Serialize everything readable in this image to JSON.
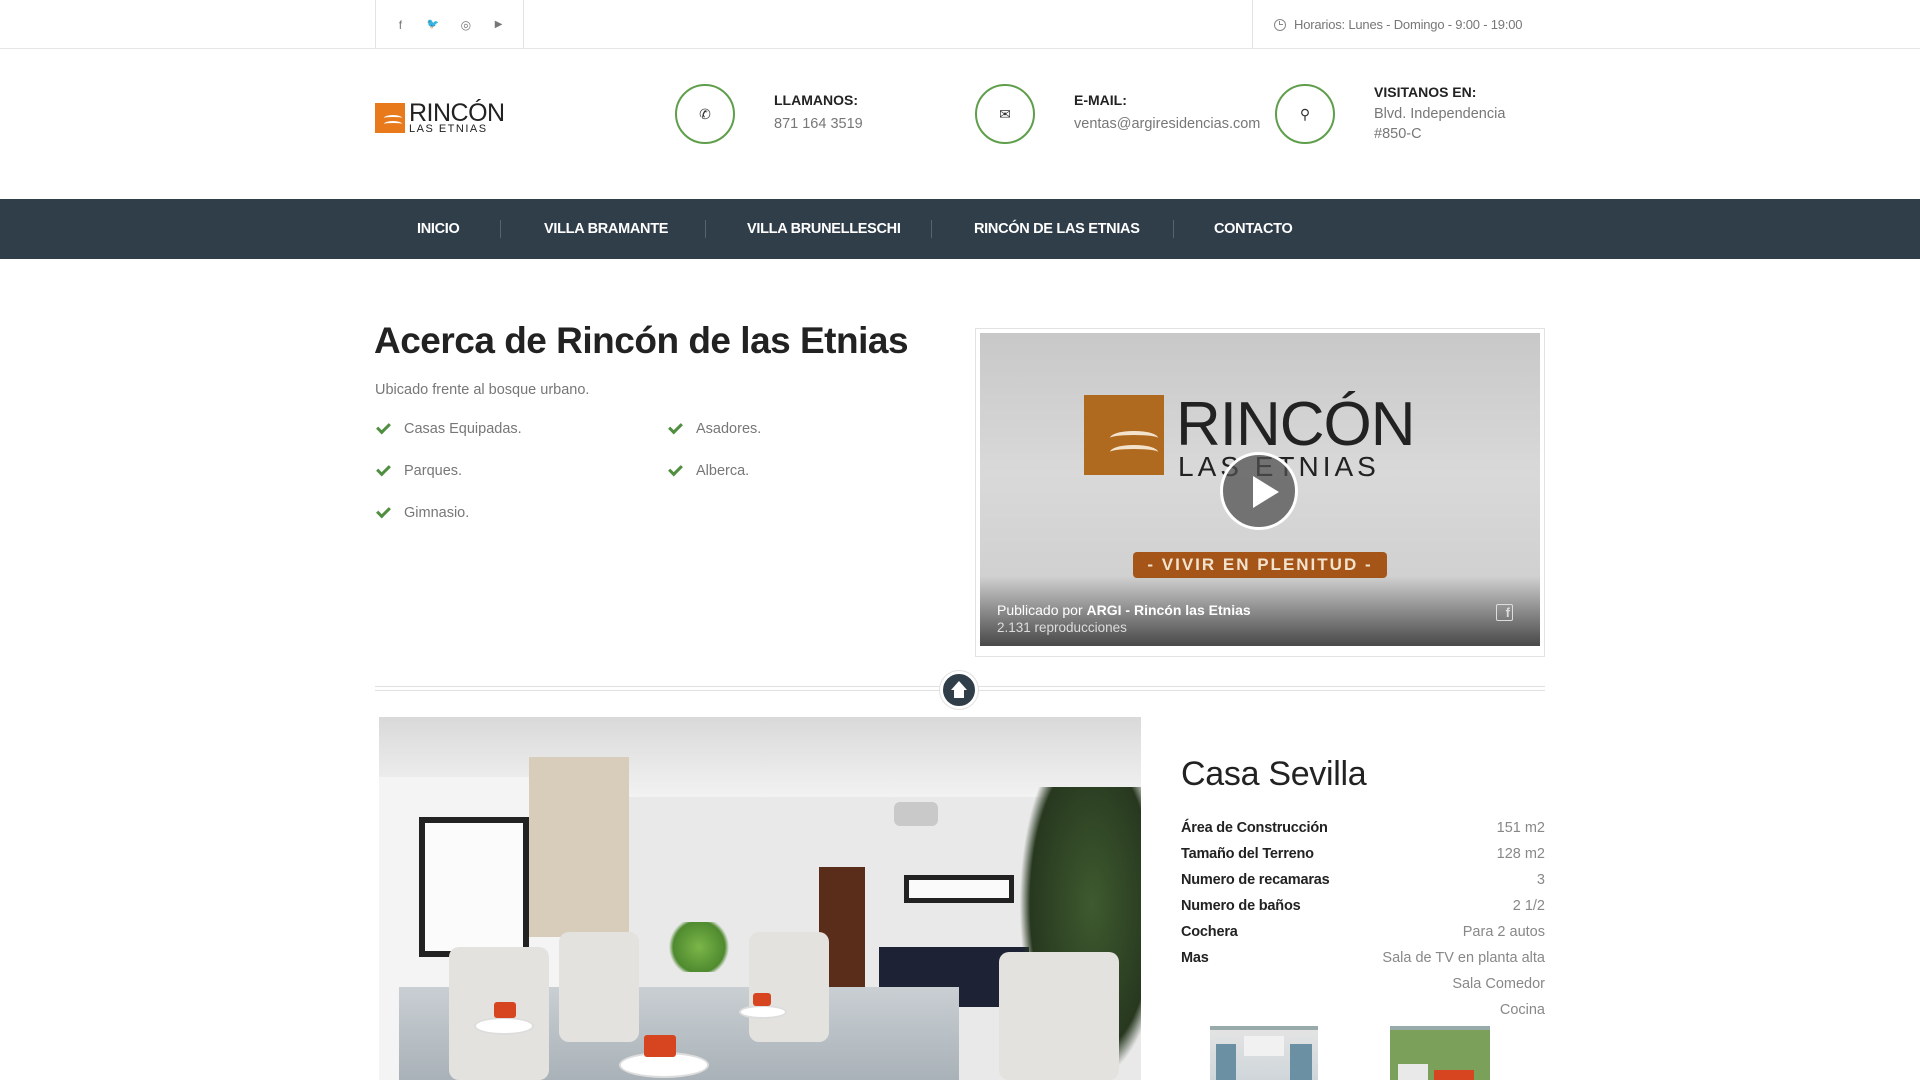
{
  "topbar": {
    "social_icons": [
      {
        "name": "facebook-icon",
        "glyph": "f"
      },
      {
        "name": "twitter-icon",
        "glyph": "🐦"
      },
      {
        "name": "instagram-icon",
        "glyph": "◎"
      },
      {
        "name": "youtube-icon",
        "glyph": "▶"
      }
    ],
    "hours": "Horarios: Lunes - Domingo - 9:00 - 19:00"
  },
  "logo": {
    "line1": "RINCÓN",
    "line2": "LAS ETNIAS"
  },
  "contacts": [
    {
      "icon": "phone-icon",
      "glyph": "✆",
      "title": "LLAMANOS:",
      "value": "871 164 3519"
    },
    {
      "icon": "email-icon",
      "glyph": "✉",
      "title": "E-MAIL:",
      "value": "ventas@argiresidencias.com"
    },
    {
      "icon": "location-pin-icon",
      "glyph": "⚲",
      "title": "VISITANOS EN:",
      "value": "Blvd. Independencia",
      "value2": "#850-C"
    }
  ],
  "nav": [
    "INICIO",
    "VILLA BRAMANTE",
    "VILLA BRUNELLESCHI",
    "RINCÓN DE LAS ETNIAS",
    "CONTACTO"
  ],
  "about": {
    "title": "Acerca de Rincón de las Etnias",
    "subtitle": "Ubicado frente al bosque urbano.",
    "features_left": [
      "Casas Equipadas.",
      "Parques.",
      "Gimnasio."
    ],
    "features_right": [
      "Asadores.",
      "Alberca."
    ]
  },
  "video": {
    "logo_line1": "RINCÓN",
    "logo_line2": "LAS ETNIAS",
    "tagline": "- VIVIR EN PLENITUD -",
    "published_prefix": "Publicado por ",
    "publisher": "ARGI - Rincón las Etnias",
    "views": "2.131 reproducciones"
  },
  "casa": {
    "title": "Casa Sevilla",
    "specs": [
      {
        "label": "Área de Construcción",
        "value": "151 m2"
      },
      {
        "label": "Tamaño del Terreno",
        "value": "128 m2"
      },
      {
        "label": "Numero de recamaras",
        "value": "3"
      },
      {
        "label": "Numero de baños",
        "value": "2 1/2"
      },
      {
        "label": "Cochera",
        "value": "Para 2 autos"
      },
      {
        "label": "Mas",
        "value": "Sala de TV en planta alta"
      }
    ],
    "extras": [
      "Sala Comedor",
      "Cocina"
    ]
  },
  "colors": {
    "nav_bg": "#2f3e48",
    "accent_green": "#5f9e4a",
    "logo_orange": "#e87a1c"
  }
}
